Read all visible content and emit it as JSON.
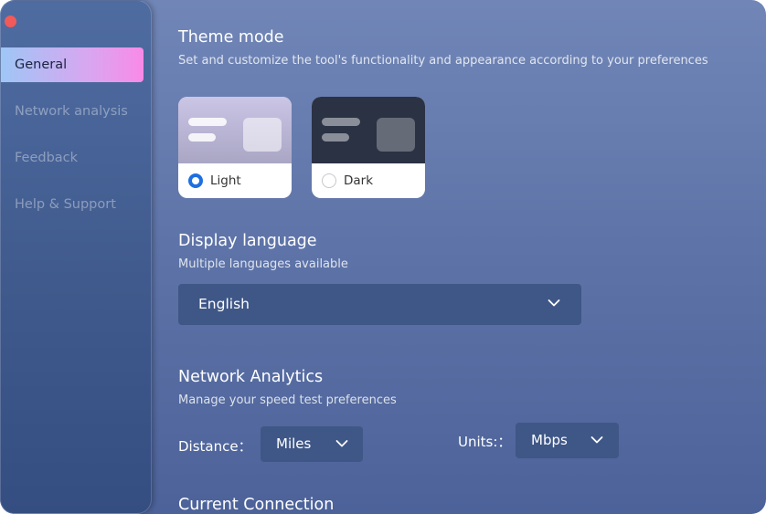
{
  "sidebar": {
    "items": [
      {
        "label": "General",
        "active": true
      },
      {
        "label": "Network analysis",
        "active": false
      },
      {
        "label": "Feedback",
        "active": false
      },
      {
        "label": "Help & Support",
        "active": false
      }
    ]
  },
  "theme": {
    "title": "Theme mode",
    "subtitle": "Set and customize the tool's functionality and appearance according to your preferences",
    "options": [
      {
        "label": "Light",
        "selected": true
      },
      {
        "label": "Dark",
        "selected": false
      }
    ]
  },
  "language": {
    "title": "Display language",
    "subtitle": "Multiple languages available",
    "selected": "English"
  },
  "network": {
    "title": "Network Analytics",
    "subtitle": "Manage your speed test preferences",
    "distance_label": "Distance：",
    "distance_value": "Miles",
    "units_label": "Units:：",
    "units_value": "Mbps"
  },
  "connection": {
    "title": "Current Connection"
  },
  "colors": {
    "accent": "#1f6fe0",
    "close": "#f05a5a",
    "active_gradient_start": "#9fc6f6",
    "active_gradient_end": "#f98ae6",
    "select_bg": "#3f5787"
  }
}
